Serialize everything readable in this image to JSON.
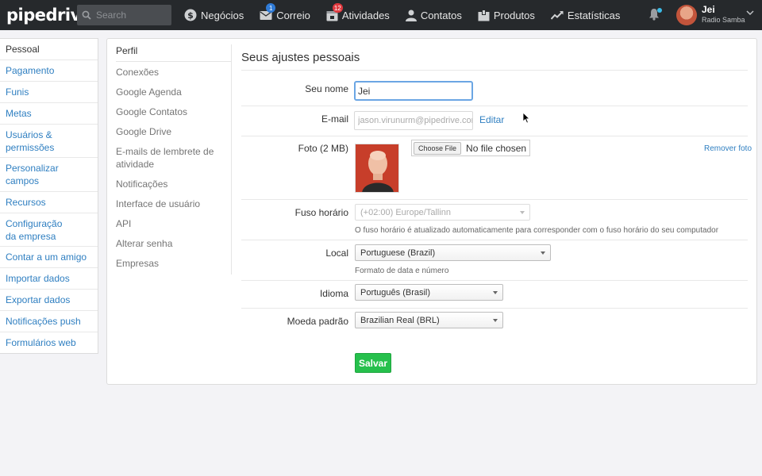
{
  "app": {
    "logo": "pipedrive"
  },
  "search": {
    "placeholder": "Search"
  },
  "nav": [
    {
      "label": "Negócios",
      "icon": "dollar-icon"
    },
    {
      "label": "Correio",
      "icon": "mail-icon",
      "badge": "1"
    },
    {
      "label": "Atividades",
      "icon": "calendar-icon",
      "badge": "12"
    },
    {
      "label": "Contatos",
      "icon": "person-icon"
    },
    {
      "label": "Produtos",
      "icon": "box-icon"
    },
    {
      "label": "Estatísticas",
      "icon": "chart-icon"
    }
  ],
  "user": {
    "name": "Jei",
    "company": "Radio Samba"
  },
  "sidebar": {
    "items": [
      {
        "label": "Pessoal"
      },
      {
        "label": "Pagamento"
      },
      {
        "label": "Funis"
      },
      {
        "label": "Metas"
      },
      {
        "label": "Usuários & permissões"
      },
      {
        "label": "Personalizar campos"
      },
      {
        "label": "Recursos"
      },
      {
        "label": "Configuração da empresa"
      },
      {
        "label": "Contar a um amigo"
      },
      {
        "label": "Importar dados"
      },
      {
        "label": "Exportar dados"
      },
      {
        "label": "Notificações push"
      },
      {
        "label": "Formulários web"
      }
    ]
  },
  "subnav": {
    "items": [
      {
        "label": "Perfil"
      },
      {
        "label": "Conexões"
      },
      {
        "label": "Google Agenda"
      },
      {
        "label": "Google Contatos"
      },
      {
        "label": "Google Drive"
      },
      {
        "label": "E-mails de lembrete de atividade"
      },
      {
        "label": "Notificações"
      },
      {
        "label": "Interface de usuário"
      },
      {
        "label": "API"
      },
      {
        "label": "Alterar senha"
      },
      {
        "label": "Empresas"
      }
    ]
  },
  "form": {
    "title": "Seus ajustes pessoais",
    "name_label": "Seu nome",
    "name_value": "Jei",
    "email_label": "E-mail",
    "email_value": "jason.virunurm@pipedrive.com",
    "email_edit": "Editar",
    "photo_label": "Foto (2 MB)",
    "file_button": "Choose File",
    "file_text": "No file chosen",
    "photo_remove": "Remover foto",
    "tz_label": "Fuso horário",
    "tz_value": "(+02:00) Europe/Tallinn",
    "tz_help": "O fuso horário é atualizado automaticamente para corresponder com o fuso horário do seu computador",
    "locale_label": "Local",
    "locale_value": "Portuguese (Brazil)",
    "locale_help": "Formato de data e número",
    "lang_label": "Idioma",
    "lang_value": "Português (Brasil)",
    "currency_label": "Moeda padrão",
    "currency_value": "Brazilian Real (BRL)",
    "save": "Salvar"
  }
}
